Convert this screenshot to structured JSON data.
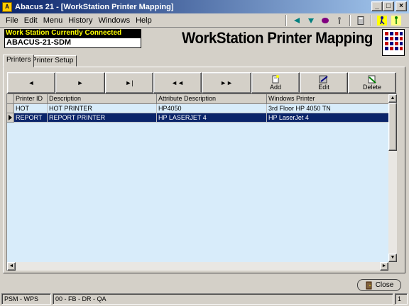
{
  "window": {
    "title": "Abacus 21 - [WorkStation Printer Mapping]"
  },
  "menu": [
    "File",
    "Edit",
    "Menu",
    "History",
    "Windows",
    "Help"
  ],
  "workstation": {
    "label": "Work Station Currently Connected",
    "value": "ABACUS-21-SDM"
  },
  "page_title": "WorkStation Printer Mapping",
  "tabs": [
    "Printers",
    "Printer Setup"
  ],
  "nav": {
    "first": "◄",
    "next": "►",
    "last": "►|",
    "prev_page": "◄◄",
    "next_page": "►►"
  },
  "actions": {
    "add": "Add",
    "edit": "Edit",
    "delete": "Delete"
  },
  "grid": {
    "columns": [
      "Printer ID",
      "Description",
      "Attribute Description",
      "Windows Printer"
    ],
    "rows": [
      [
        "HOT",
        "HOT PRINTER",
        "HP4050",
        "3rd Floor HP 4050 TN"
      ],
      [
        "REPORT",
        "REPORT PRINTER",
        "HP LASERJET 4",
        "HP LaserJet 4"
      ]
    ],
    "selected_row": 1
  },
  "close_label": "Close",
  "status": {
    "module": "PSM - WPS",
    "codes": "00 - FB - DR - QA",
    "page": "1"
  },
  "colors": {
    "title_bar": "#0a246a",
    "grid_bg": "#d8ecfa",
    "selection": "#0a246a",
    "label_text": "#ffff00"
  }
}
